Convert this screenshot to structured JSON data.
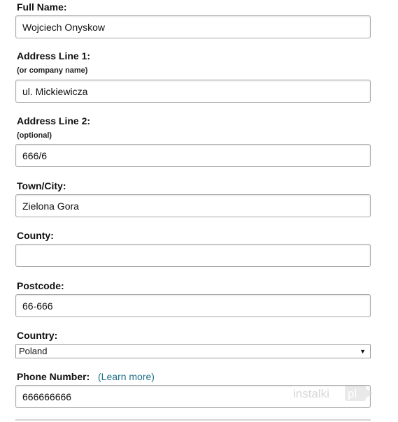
{
  "form": {
    "full_name": {
      "label": "Full Name:",
      "value": "Wojciech Onyskow"
    },
    "address_line_1": {
      "label": "Address Line 1:",
      "hint": "(or company name)",
      "value": "ul. Mickiewicza"
    },
    "address_line_2": {
      "label": "Address Line 2:",
      "hint": "(optional)",
      "value": "666/6"
    },
    "town_city": {
      "label": "Town/City:",
      "value": "Zielona Gora"
    },
    "county": {
      "label": "County:",
      "value": ""
    },
    "postcode": {
      "label": "Postcode:",
      "value": "66-666"
    },
    "country": {
      "label": "Country:",
      "selected": "Poland",
      "arrow": "▼"
    },
    "phone_number": {
      "label": "Phone Number:",
      "learn_more_open": "(",
      "learn_more": "Learn more",
      "learn_more_close": ")",
      "value": "666666666"
    }
  },
  "watermark": {
    "text_part1": "instalki",
    "text_part2": "pl"
  }
}
